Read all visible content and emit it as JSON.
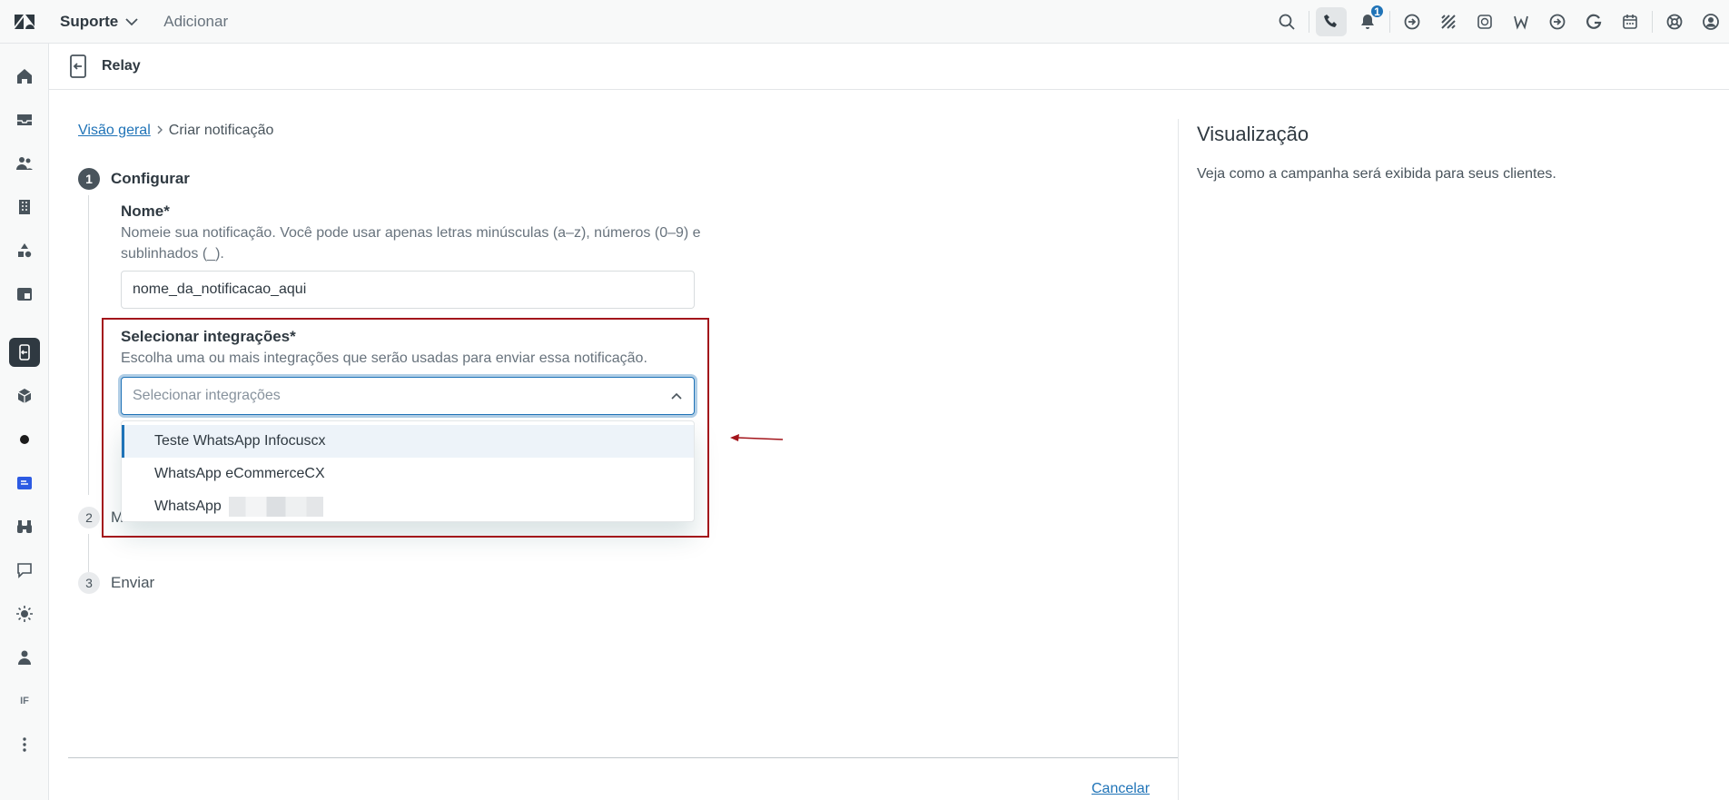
{
  "topbar": {
    "product": "Suporte",
    "add": "Adicionar",
    "notification_count": "1"
  },
  "sidebar": {
    "bottom_label": "IF"
  },
  "header": {
    "title": "Relay"
  },
  "breadcrumb": {
    "parent": "Visão geral",
    "current": "Criar notificação"
  },
  "steps": [
    {
      "num": "1",
      "label": "Configurar"
    },
    {
      "num": "2",
      "label": "M"
    },
    {
      "num": "3",
      "label": "Enviar"
    }
  ],
  "form": {
    "name_label": "Nome*",
    "name_hint": "Nomeie sua notificação. Você pode usar apenas letras minúsculas (a–z), números (0–9) e sublinhados (_).",
    "name_value": "nome_da_notificacao_aqui",
    "integrations_label": "Selecionar integrações*",
    "integrations_hint": "Escolha uma ou mais integrações que serão usadas para enviar essa notificação.",
    "integrations_placeholder": "Selecionar integrações",
    "options": [
      "Teste WhatsApp Infocuscx",
      "WhatsApp eCommerceCX",
      "WhatsApp"
    ]
  },
  "footer": {
    "cancel": "Cancelar"
  },
  "preview": {
    "title": "Visualização",
    "description": "Veja como a campanha será exibida para seus clientes."
  },
  "colors": {
    "accent": "#1f73b7",
    "highlight_border": "#a3141b",
    "arrow": "#a3141b"
  }
}
